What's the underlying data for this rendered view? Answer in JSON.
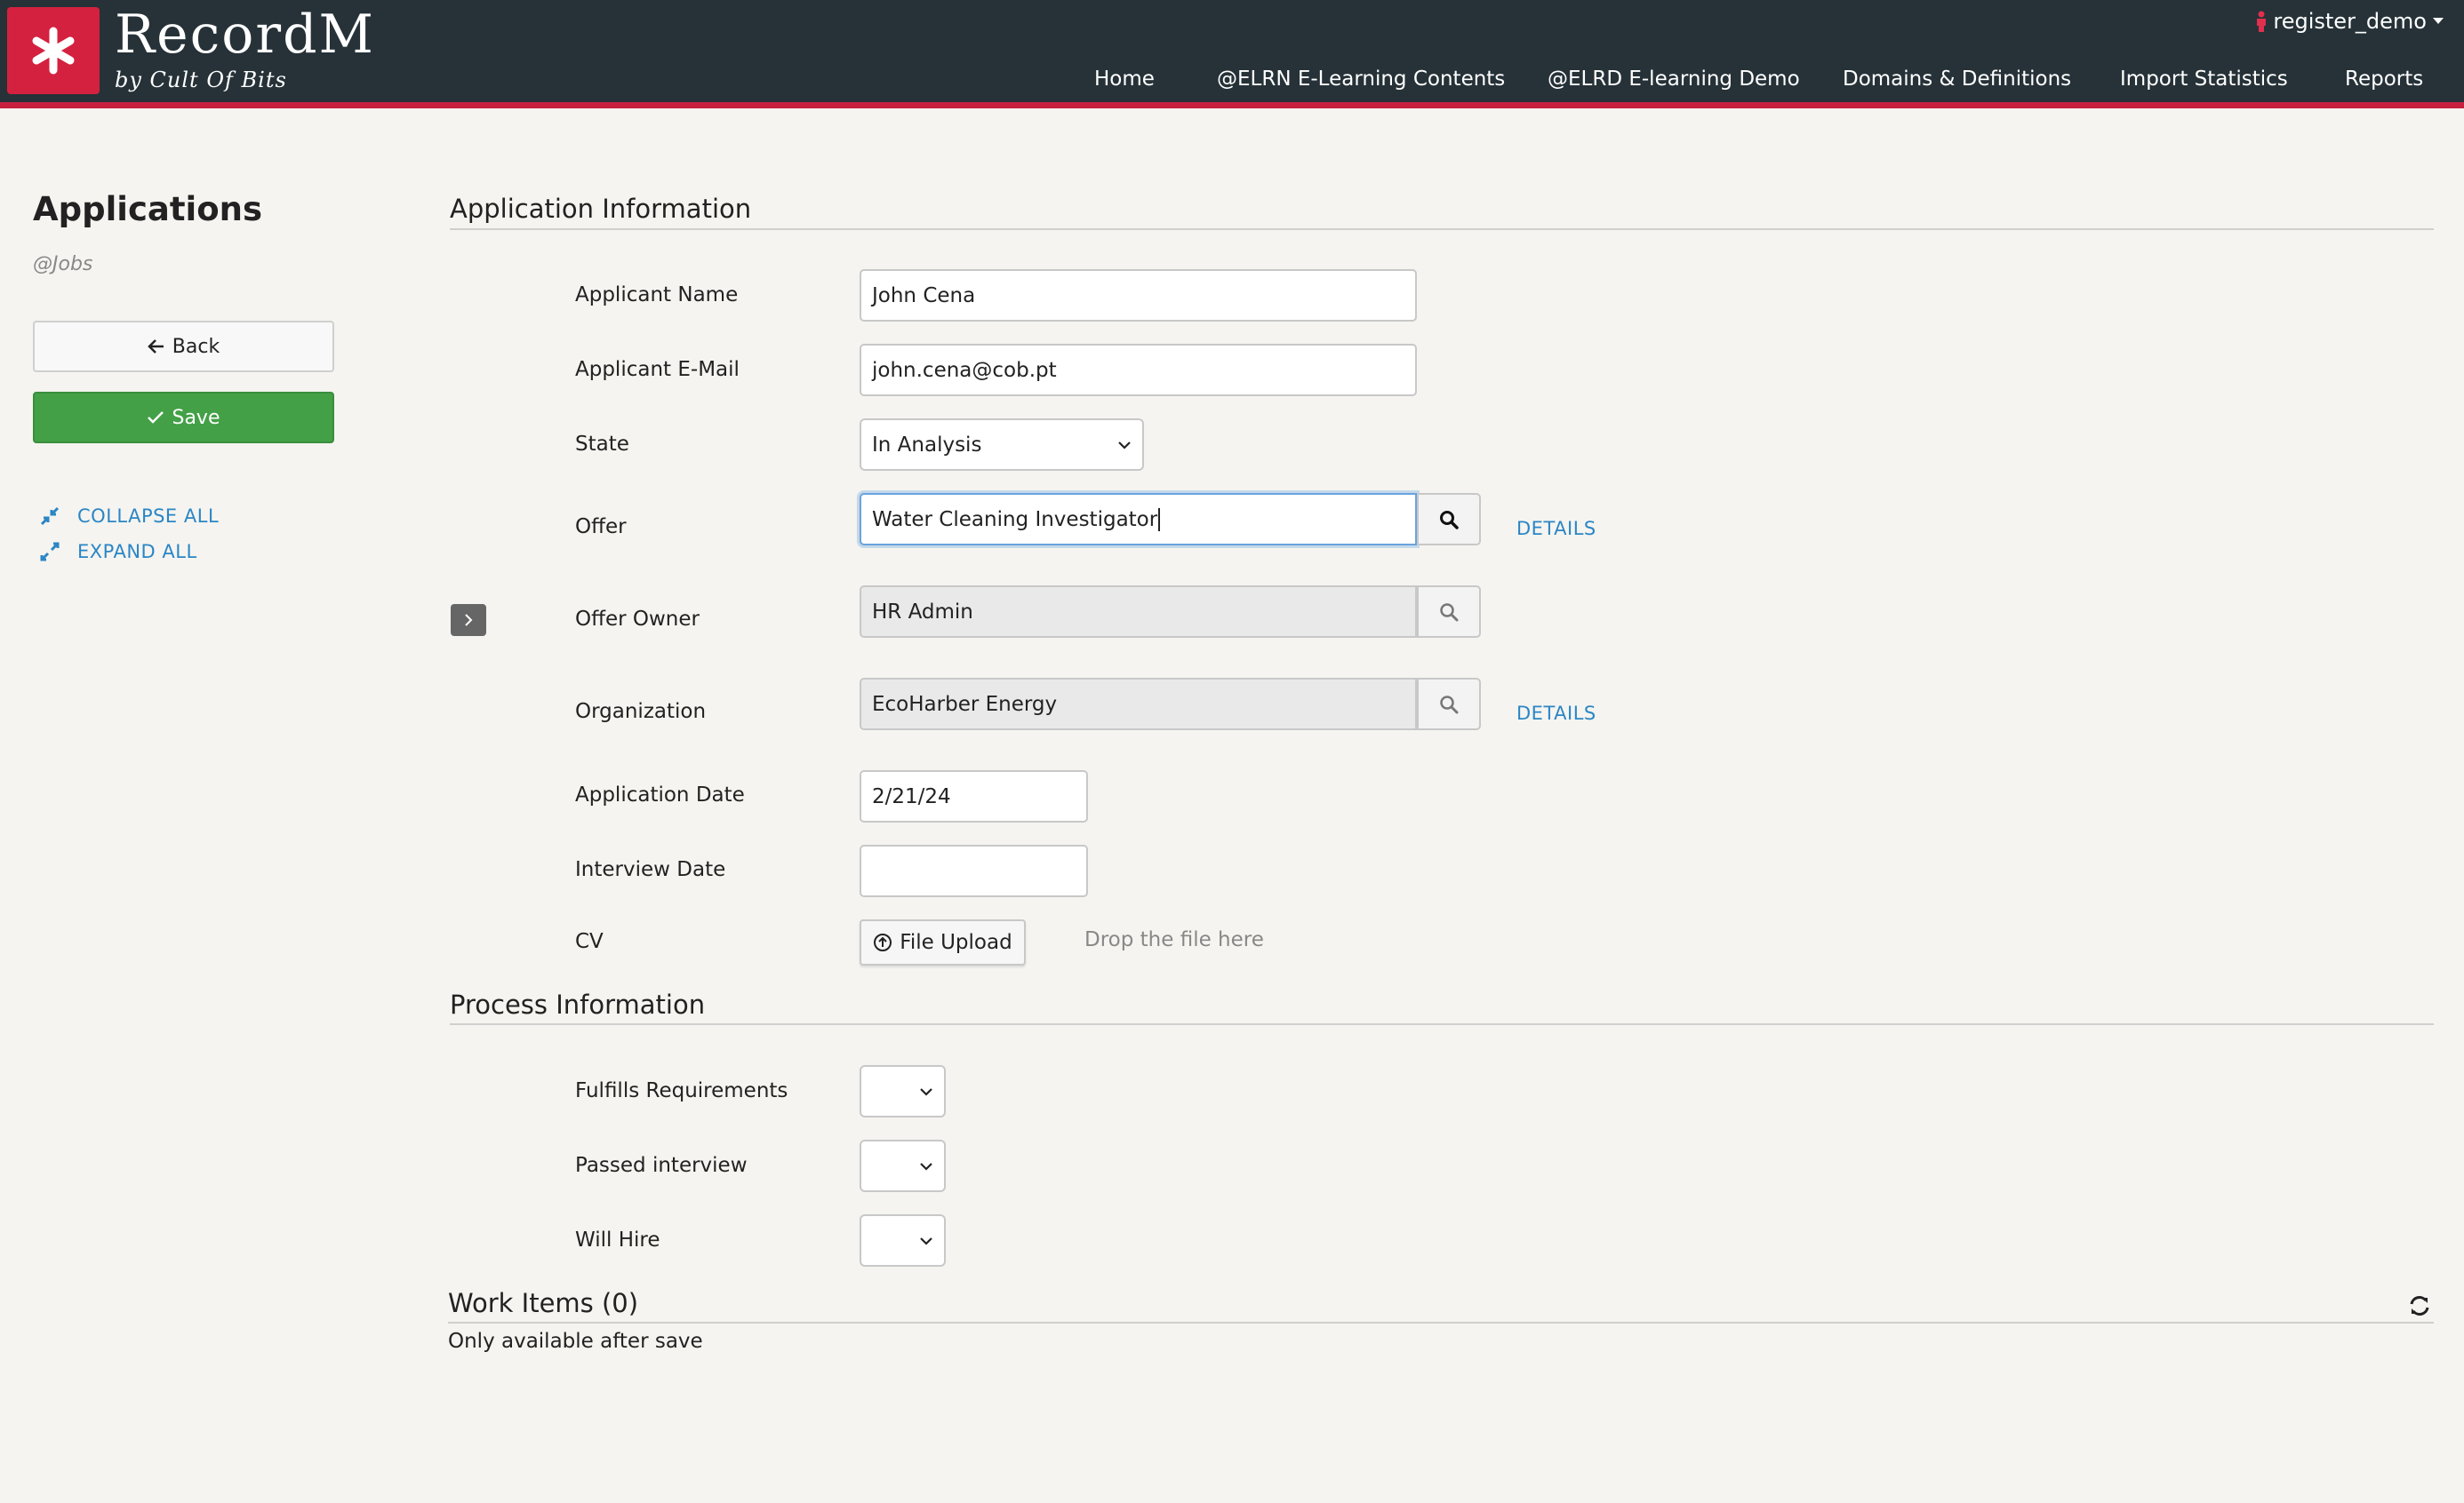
{
  "brand": {
    "title": "RecordM",
    "subtitle": "by Cult Of Bits",
    "logo_icon": "asterisk-icon",
    "accent_color": "#d4213f",
    "header_color": "#263238"
  },
  "user_menu": {
    "username": "register_demo",
    "icon": "user-icon"
  },
  "nav": {
    "items": [
      {
        "label": "Home"
      },
      {
        "label": "@ELRN E-Learning Contents"
      },
      {
        "label": "@ELRD E-learning Demo"
      },
      {
        "label": "Domains & Definitions"
      },
      {
        "label": "Import Statistics"
      },
      {
        "label": "Reports"
      }
    ]
  },
  "sidebar": {
    "title": "Applications",
    "subtitle": "@Jobs",
    "back_label": "Back",
    "save_label": "Save",
    "collapse_label": "COLLAPSE ALL",
    "expand_label": "EXPAND ALL"
  },
  "application_info": {
    "section_title": "Application Information",
    "applicant_name": {
      "label": "Applicant Name",
      "value": "John Cena"
    },
    "applicant_email": {
      "label": "Applicant E-Mail",
      "value": "john.cena@cob.pt"
    },
    "state": {
      "label": "State",
      "value": "In Analysis"
    },
    "offer": {
      "label": "Offer",
      "value": "Water Cleaning Investigator",
      "details": "DETAILS"
    },
    "offer_owner": {
      "label": "Offer Owner",
      "value": "HR Admin"
    },
    "organization": {
      "label": "Organization",
      "value": "EcoHarber Energy",
      "details": "DETAILS"
    },
    "application_date": {
      "label": "Application Date",
      "value": "2/21/24"
    },
    "interview_date": {
      "label": "Interview Date",
      "value": ""
    },
    "cv": {
      "label": "CV",
      "upload_label": "File Upload",
      "drop_text": "Drop the file here"
    }
  },
  "process_info": {
    "section_title": "Process Information",
    "fulfills_requirements": {
      "label": "Fulfills Requirements",
      "value": ""
    },
    "passed_interview": {
      "label": "Passed interview",
      "value": ""
    },
    "will_hire": {
      "label": "Will Hire",
      "value": ""
    }
  },
  "work_items": {
    "title": "Work Items (0)",
    "note": "Only available after save"
  }
}
